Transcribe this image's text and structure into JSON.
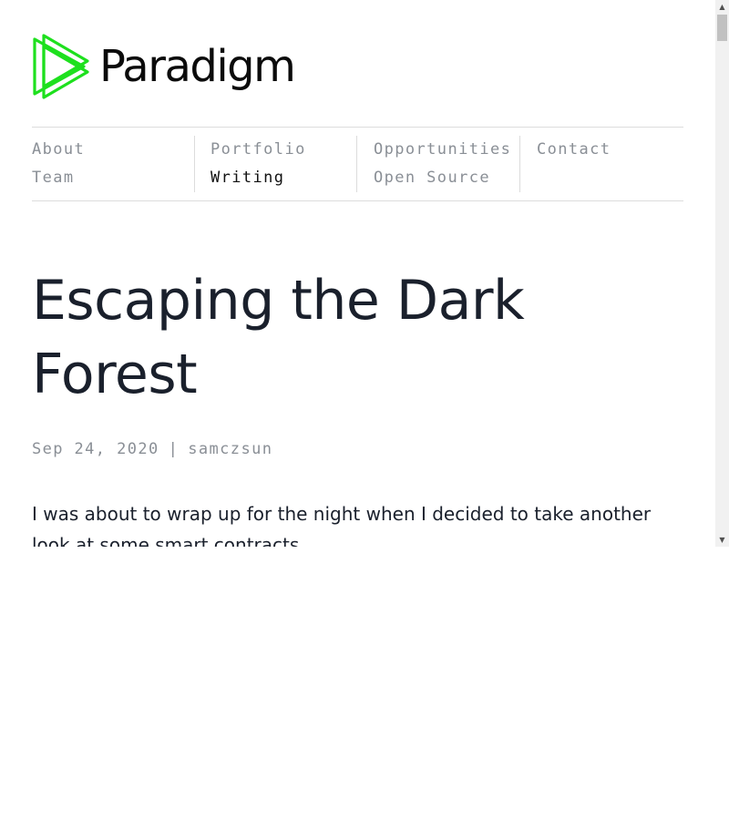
{
  "brand": {
    "name": "Paradigm",
    "logo_color": "#1ee01e",
    "text_color": "#0b0b0b"
  },
  "nav": {
    "columns": [
      {
        "links": [
          {
            "label": "About",
            "active": false
          },
          {
            "label": "Team",
            "active": false
          }
        ]
      },
      {
        "links": [
          {
            "label": "Portfolio",
            "active": false
          },
          {
            "label": "Writing",
            "active": true
          }
        ]
      },
      {
        "links": [
          {
            "label": "Opportunities",
            "active": false
          },
          {
            "label": "Open Source",
            "active": false
          }
        ]
      },
      {
        "links": [
          {
            "label": "Contact",
            "active": false
          }
        ]
      }
    ]
  },
  "article": {
    "title": "Escaping the Dark Forest",
    "date": "Sep 24, 2020",
    "separator": "|",
    "author": "samczsun",
    "intro": "I was about to wrap up for the night when I decided to take another look at some smart contracts."
  },
  "scrollbar": {
    "up_icon": "▲",
    "down_icon": "▼"
  },
  "colors": {
    "muted": "#8a8f96",
    "heading": "#1a202c",
    "divider": "#dcdcdc"
  }
}
